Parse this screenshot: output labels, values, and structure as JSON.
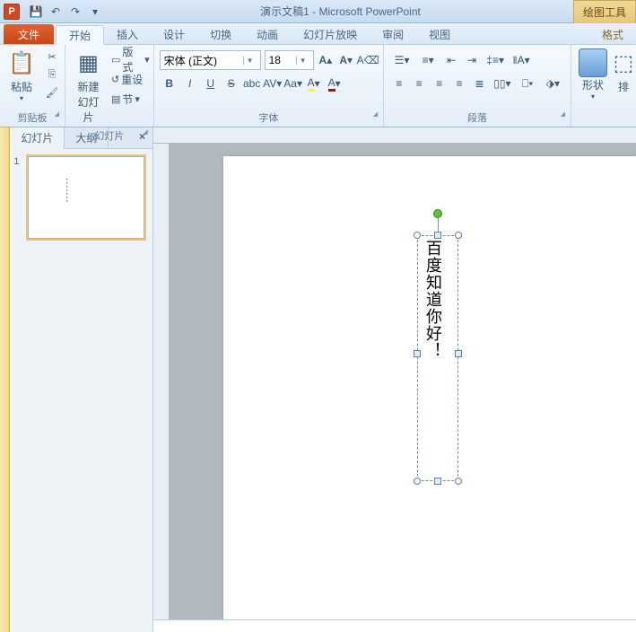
{
  "title": "演示文稿1 - Microsoft PowerPoint",
  "tool_tab": {
    "line1": "绘图工具",
    "line2": "格式"
  },
  "qat": {
    "save": "💾",
    "undo": "↶",
    "redo": "↷"
  },
  "tabs": {
    "file": "文件",
    "home": "开始",
    "insert": "插入",
    "design": "设计",
    "transition": "切换",
    "animation": "动画",
    "slideshow": "幻灯片放映",
    "review": "审阅",
    "view": "视图",
    "format": "格式"
  },
  "groups": {
    "clipboard": {
      "label": "剪贴板",
      "paste": "粘贴"
    },
    "slides": {
      "label": "幻灯片",
      "new_slide": "新建\n幻灯片",
      "layout": "版式",
      "reset": "重设",
      "section": "节"
    },
    "font": {
      "label": "字体",
      "name": "宋体 (正文)",
      "size": "18",
      "bold": "B",
      "italic": "I",
      "underline": "U",
      "strike": "S",
      "shadow": "abc",
      "spacing": "AV",
      "case": "Aa"
    },
    "paragraph": {
      "label": "段落"
    },
    "drawing": {
      "shapes": "形状",
      "arrange": "排"
    }
  },
  "side": {
    "slides_tab": "幻灯片",
    "outline_tab": "大纲",
    "close": "×",
    "slide_num": "1"
  },
  "textbox_content": "百度知道你好！"
}
